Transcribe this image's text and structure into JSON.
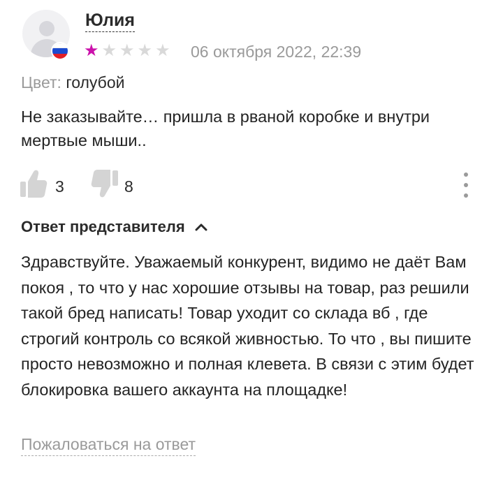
{
  "review": {
    "author": "Юлия",
    "country_flag": "russia-flag",
    "rating": 1,
    "rating_max": 5,
    "star_color_filled": "#cb11ab",
    "star_color_empty": "#d9d9d9",
    "date": "06 октября 2022, 22:39",
    "color_label": "Цвет:",
    "color_value": "голубой",
    "text": "Не заказывайте… пришла в рваной коробке и внутри мертвые мыши..",
    "likes": "3",
    "dislikes": "8"
  },
  "reply": {
    "title": "Ответ представителя",
    "text": "Здравствуйте. Уважаемый конкурент, видимо не даёт Вам покоя , то что у нас хорошие отзывы на товар, раз решили такой бред написать! Товар уходит со склада вб , где строгий контроль со всякой живностью. То что , вы пишите просто невозможно и полная клевета. В связи с этим будет блокировка вашего аккаунта на площадке!",
    "report_link": "Пожаловаться на ответ"
  }
}
